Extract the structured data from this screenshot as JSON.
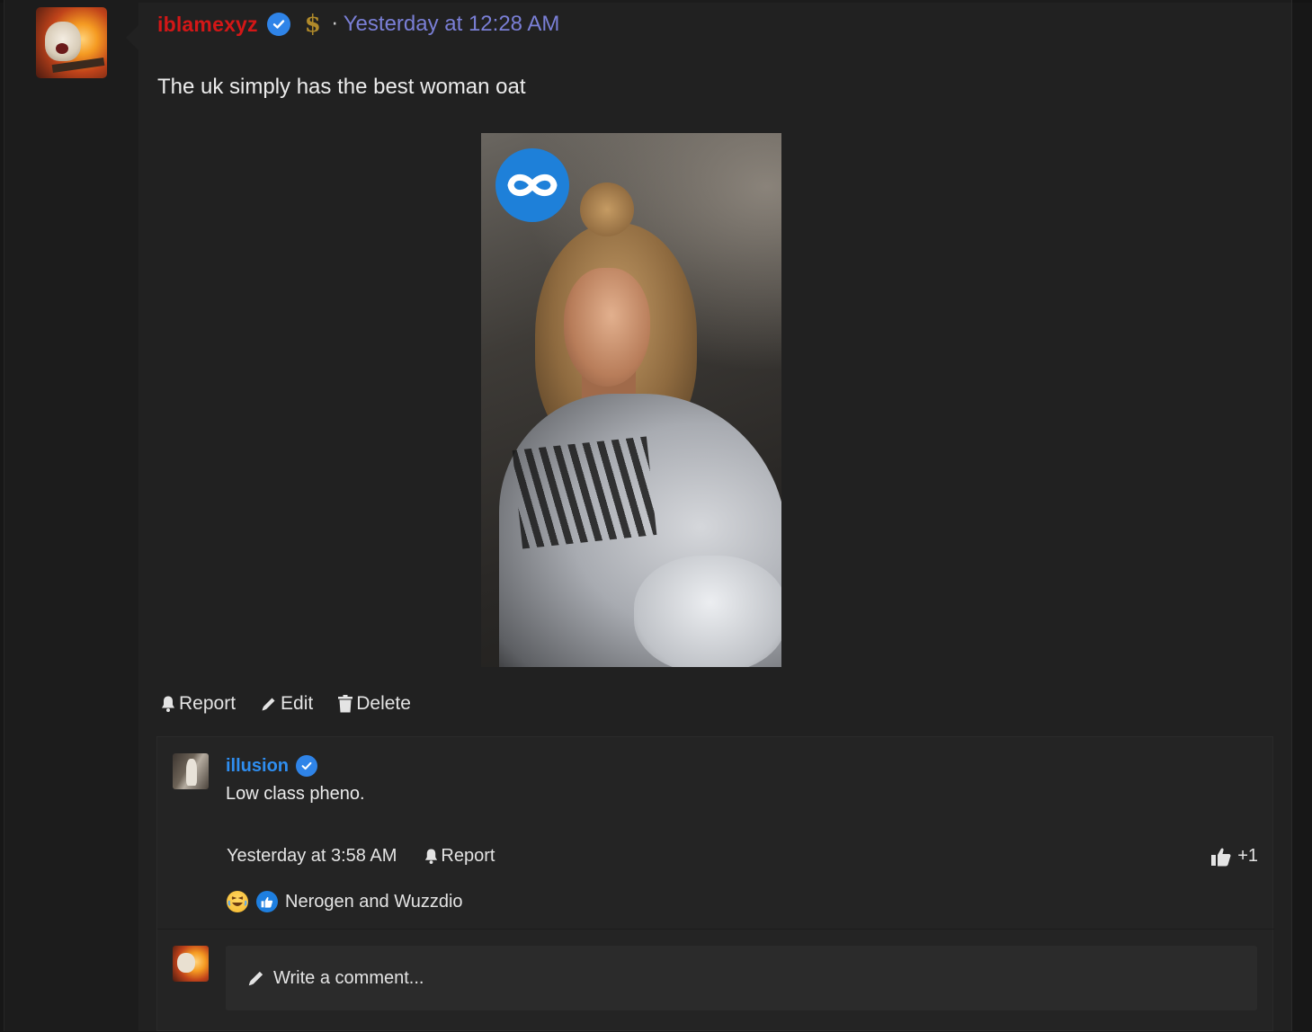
{
  "post": {
    "author": "iblamexyz",
    "timestamp": "Yesterday at 12:28 AM",
    "separator": "·",
    "body": "The uk simply has the best woman oat",
    "actions": {
      "report": "Report",
      "edit": "Edit",
      "delete": "Delete"
    },
    "badges": [
      "verified-icon",
      "dollar-icon"
    ],
    "image_watermark": "infinity-logo-icon"
  },
  "comment": {
    "author": "illusion",
    "text": "Low class pheno.",
    "timestamp": "Yesterday at 3:58 AM",
    "report_label": "Report",
    "like_count": "+1",
    "reactions": [
      "laughing-crying-emoji",
      "thumbs-up-emoji"
    ],
    "reacted_by": "Nerogen and Wuzzdio"
  },
  "compose": {
    "placeholder": "Write a comment..."
  },
  "colors": {
    "author_red": "#d31717",
    "timestamp_purple": "#7a7fd6",
    "comment_author_blue": "#2f8ef0",
    "verified_blue": "#2f84e8"
  }
}
